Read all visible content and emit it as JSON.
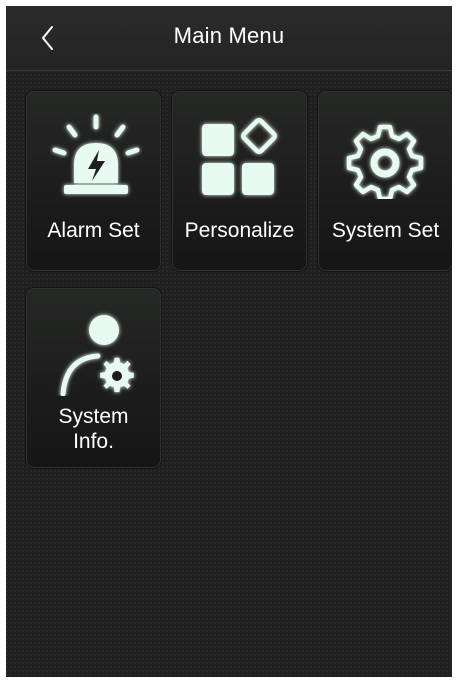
{
  "header": {
    "title": "Main Menu",
    "back_icon": "chevron-left-icon"
  },
  "menu": {
    "items": [
      {
        "label": "Alarm Set",
        "icon": "alarm-light-icon"
      },
      {
        "label": "Personalize",
        "icon": "apps-grid-icon"
      },
      {
        "label": "System Set",
        "icon": "gear-icon"
      },
      {
        "label_line1": "System",
        "label_line2": "Info.",
        "icon": "user-settings-icon"
      }
    ]
  },
  "colors": {
    "accent": "#e7fbf3",
    "glow": "#6fe2b6",
    "background": "#1e1f1e"
  }
}
